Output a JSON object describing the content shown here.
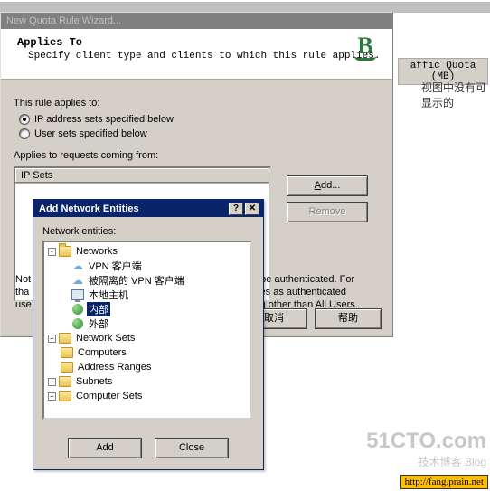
{
  "bg": {
    "column_header": "affic Quota (MB)",
    "right_text": "视图中没有可显示的"
  },
  "wizard": {
    "title": "New Quota Rule Wizard...",
    "header_title": "Applies To",
    "header_sub": "Specify client type and clients to which this rule applies.",
    "rule_applies_label": "This rule applies to:",
    "radio_ip": "IP address sets specified below",
    "radio_users": "User sets specified below",
    "requests_label": "Applies to requests coming from:",
    "list_header": "IP Sets",
    "add_btn": "Add...",
    "remove_btn": "Remove",
    "note_fragment": "Not\ntha\nuse",
    "note_right_1": "d be authenticated. For",
    "note_right_2": "ules as authenticated",
    "note_right_3": "ing other than All Users.",
    "cancel_btn": "取消",
    "help_btn": "帮助"
  },
  "dialog": {
    "title": "Add Network Entities",
    "net_entities_label": "Network entities:",
    "tree": {
      "networks": "Networks",
      "vpn_clients": "VPN 客户端",
      "isolated_vpn": "被隔离的 VPN 客户端",
      "local_host": "本地主机",
      "internal": "内部",
      "external": "外部",
      "network_sets": "Network Sets",
      "computers": "Computers",
      "address_ranges": "Address Ranges",
      "subnets": "Subnets",
      "computer_sets": "Computer Sets"
    },
    "add_btn": "Add",
    "close_btn": "Close"
  },
  "watermark": {
    "big": "51CTO.com",
    "small": "技术博客   Blog"
  },
  "url_badge": "http://fang.prain.net"
}
